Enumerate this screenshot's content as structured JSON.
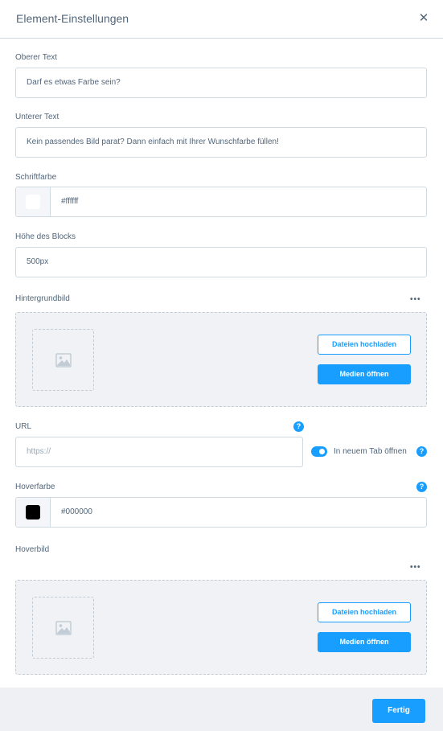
{
  "header": {
    "title": "Element-Einstellungen",
    "close_glyph": "✕"
  },
  "fields": {
    "top_text": {
      "label": "Oberer Text",
      "value": "Darf es etwas Farbe sein?"
    },
    "bottom_text": {
      "label": "Unterer Text",
      "value": "Kein passendes Bild parat? Dann einfach mit Ihrer Wunschfarbe füllen!"
    },
    "font_color": {
      "label": "Schriftfarbe",
      "value": "#ffffff",
      "swatch": "#ffffff"
    },
    "block_height": {
      "label": "Höhe des Blocks",
      "value": "500px"
    },
    "background_image": {
      "label": "Hintergrundbild",
      "upload_label": "Dateien hochladen",
      "media_label": "Medien öffnen"
    },
    "url": {
      "label": "URL",
      "placeholder": "https://",
      "help": "?",
      "new_tab_label": "In neuem Tab öffnen",
      "new_tab_enabled": true,
      "new_tab_help": "?"
    },
    "hover_color": {
      "label": "Hoverfarbe",
      "value": "#000000",
      "swatch": "#000000",
      "help": "?"
    },
    "hover_image": {
      "label": "Hoverbild",
      "upload_label": "Dateien hochladen",
      "media_label": "Medien öffnen"
    }
  },
  "icons": {
    "more": "more-horizontal-icon",
    "image": "image-placeholder-icon",
    "help": "help-icon",
    "close": "close-icon"
  },
  "colors": {
    "accent": "#189eff",
    "text": "#52667a",
    "border": "#d1d9e0"
  },
  "footer": {
    "done_label": "Fertig"
  }
}
